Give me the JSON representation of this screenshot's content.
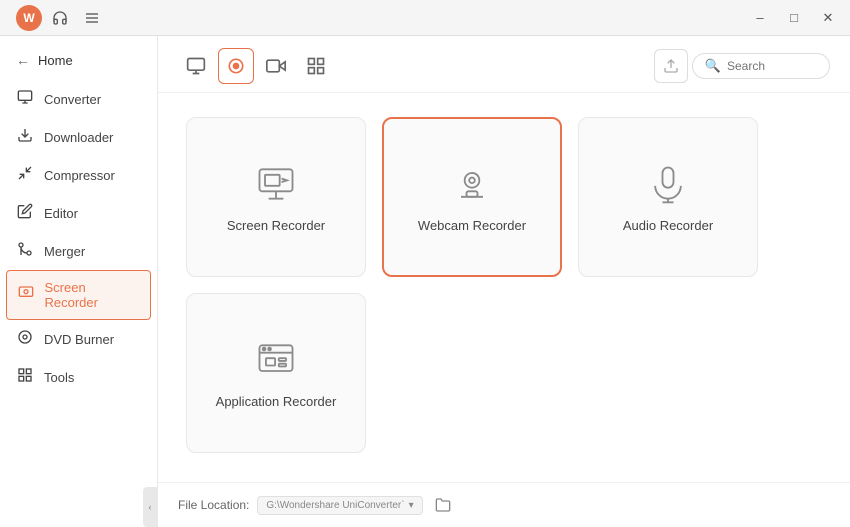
{
  "titleBar": {
    "avatarLabel": "W",
    "headsetTooltip": "Support",
    "menuTooltip": "Menu",
    "minimizeLabel": "–",
    "maximizeLabel": "□",
    "closeLabel": "✕"
  },
  "sidebar": {
    "homeLabel": "Home",
    "items": [
      {
        "id": "converter",
        "label": "Converter",
        "icon": "converter"
      },
      {
        "id": "downloader",
        "label": "Downloader",
        "icon": "downloader"
      },
      {
        "id": "compressor",
        "label": "Compressor",
        "icon": "compressor"
      },
      {
        "id": "editor",
        "label": "Editor",
        "icon": "editor"
      },
      {
        "id": "merger",
        "label": "Merger",
        "icon": "merger"
      },
      {
        "id": "screen-recorder",
        "label": "Screen Recorder",
        "icon": "screen-recorder",
        "active": true
      },
      {
        "id": "dvd-burner",
        "label": "DVD Burner",
        "icon": "dvd-burner"
      },
      {
        "id": "tools",
        "label": "Tools",
        "icon": "tools"
      }
    ]
  },
  "toolbar": {
    "tabs": [
      {
        "id": "video-converter",
        "icon": "video",
        "active": false
      },
      {
        "id": "screen-recorder-tab",
        "icon": "screen-rec",
        "active": true
      },
      {
        "id": "webcam",
        "icon": "webcam"
      },
      {
        "id": "apps",
        "icon": "apps"
      }
    ],
    "searchPlaceholder": "Search"
  },
  "cards": [
    {
      "id": "screen-recorder",
      "label": "Screen Recorder",
      "active": false
    },
    {
      "id": "webcam-recorder",
      "label": "Webcam Recorder",
      "active": true
    },
    {
      "id": "audio-recorder",
      "label": "Audio Recorder",
      "active": false
    },
    {
      "id": "application-recorder",
      "label": "Application Recorder",
      "active": false
    }
  ],
  "fileLocation": {
    "label": "File Location:",
    "path": "G:\\Wondershare UniConverter`",
    "dropdownArrow": "▾"
  },
  "colors": {
    "accent": "#e8734a",
    "border": "#e8e8e8"
  }
}
